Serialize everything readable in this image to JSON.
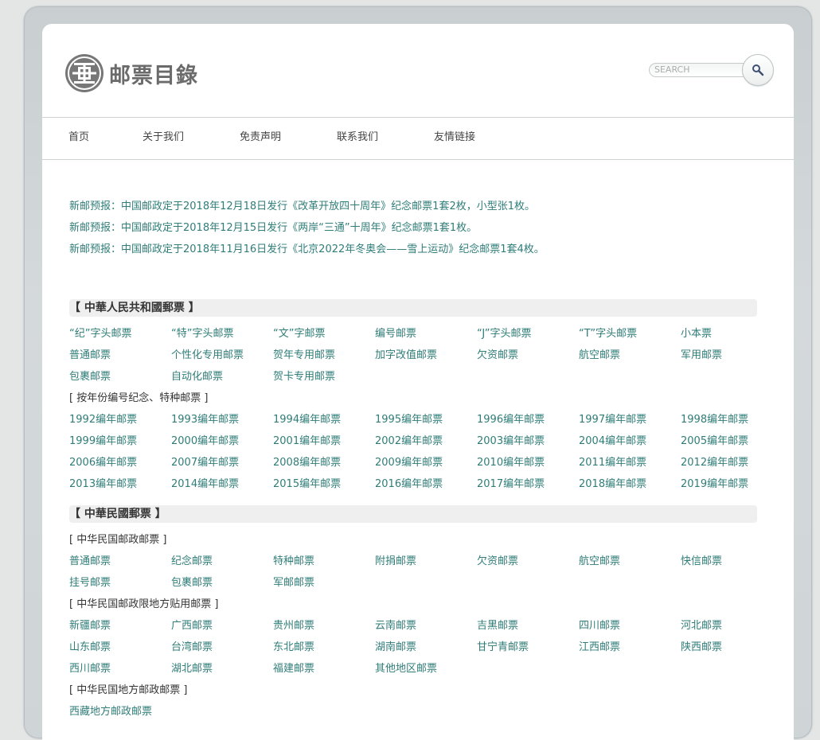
{
  "site": {
    "title": "邮票目錄",
    "search_placeholder": "SEARCH"
  },
  "nav": [
    "首页",
    "关于我们",
    "免责声明",
    "联系我们",
    "友情链接"
  ],
  "announcements": [
    "新邮预报：中国邮政定于2018年12月18日发行《改革开放四十周年》纪念邮票1套2枚，小型张1枚。",
    "新邮预报：中国邮政定于2018年12月15日发行《两岸“三通”十周年》纪念邮票1套1枚。",
    "新邮预报：中国邮政定于2018年11月16日发行《北京2022年冬奥会——雪上运动》纪念邮票1套4枚。"
  ],
  "prc": {
    "title": "【 中華人民共和國郵票 】",
    "types": [
      [
        "“纪”字头邮票",
        "“特”字头邮票",
        "“文”字邮票",
        "编号邮票",
        "“J”字头邮票",
        "“T”字头邮票",
        "小本票"
      ],
      [
        "普通邮票",
        "个性化专用邮票",
        "贺年专用邮票",
        "加字改值邮票",
        "欠资邮票",
        "航空邮票",
        "军用邮票"
      ],
      [
        "包裹邮票",
        "自动化邮票",
        "贺卡专用邮票"
      ]
    ],
    "year_title": "[ 按年份编号纪念、特种邮票 ]",
    "years": [
      [
        "1992编年邮票",
        "1993编年邮票",
        "1994编年邮票",
        "1995编年邮票",
        "1996编年邮票",
        "1997编年邮票",
        "1998编年邮票"
      ],
      [
        "1999编年邮票",
        "2000编年邮票",
        "2001编年邮票",
        "2002编年邮票",
        "2003编年邮票",
        "2004编年邮票",
        "2005编年邮票"
      ],
      [
        "2006编年邮票",
        "2007编年邮票",
        "2008编年邮票",
        "2009编年邮票",
        "2010编年邮票",
        "2011编年邮票",
        "2012编年邮票"
      ],
      [
        "2013编年邮票",
        "2014编年邮票",
        "2015编年邮票",
        "2016编年邮票",
        "2017编年邮票",
        "2018编年邮票",
        "2019编年邮票"
      ]
    ]
  },
  "roc": {
    "title": "【 中華民國郵票 】",
    "post_title": "[ 中华民国邮政邮票 ]",
    "post": [
      [
        "普通邮票",
        "纪念邮票",
        "特种邮票",
        "附捐邮票",
        "欠资邮票",
        "航空邮票",
        "快信邮票"
      ],
      [
        "挂号邮票",
        "包裹邮票",
        "军邮邮票"
      ]
    ],
    "regional_title": "[ 中华民国邮政限地方贴用邮票 ]",
    "regional": [
      [
        "新疆邮票",
        "广西邮票",
        "贵州邮票",
        "云南邮票",
        "吉黑邮票",
        "四川邮票",
        "河北邮票"
      ],
      [
        "山东邮票",
        "台湾邮票",
        "东北邮票",
        "湖南邮票",
        "甘宁青邮票",
        "江西邮票",
        "陕西邮票"
      ],
      [
        "西川邮票",
        "湖北邮票",
        "福建邮票",
        "其他地区邮票"
      ]
    ],
    "local_title": "[ 中华民国地方邮政邮票 ]",
    "local": [
      [
        "西藏地方邮政邮票"
      ]
    ]
  }
}
